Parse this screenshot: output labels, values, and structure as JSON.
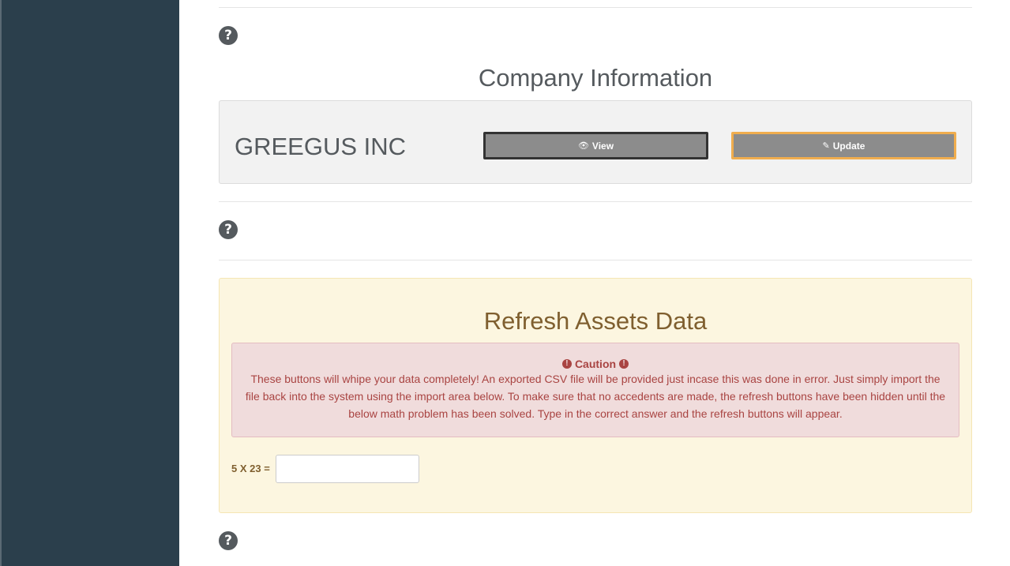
{
  "company_section": {
    "title": "Company Information",
    "company_name": "GREEGUS INC",
    "view_button": {
      "icon": "eye-icon",
      "label": "View"
    },
    "update_button": {
      "icon": "pencil-icon",
      "label": "Update"
    }
  },
  "help_icons": [
    "question-circle-icon",
    "question-circle-icon",
    "question-circle-icon"
  ],
  "refresh_section": {
    "title": "Refresh Assets Data",
    "caution": {
      "heading": "Caution",
      "icon": "exclamation-circle-icon",
      "body": "These buttons will whipe your data completely! An exported CSV file will be provided just incase this was done in error. Just simply import the file back into the system using the import area below. To make sure that no accedents are made, the refresh buttons have been hidden until the below math problem has been solved. Type in the correct answer and the refresh buttons will appear."
    },
    "math_problem": {
      "label": "5 X 23 =",
      "value": "",
      "placeholder": ""
    }
  },
  "colors": {
    "sidebar": "#2b3f4c",
    "warning_panel": "#fcf6e0",
    "danger_text": "#a94442",
    "update_border": "#f0ad4e"
  }
}
